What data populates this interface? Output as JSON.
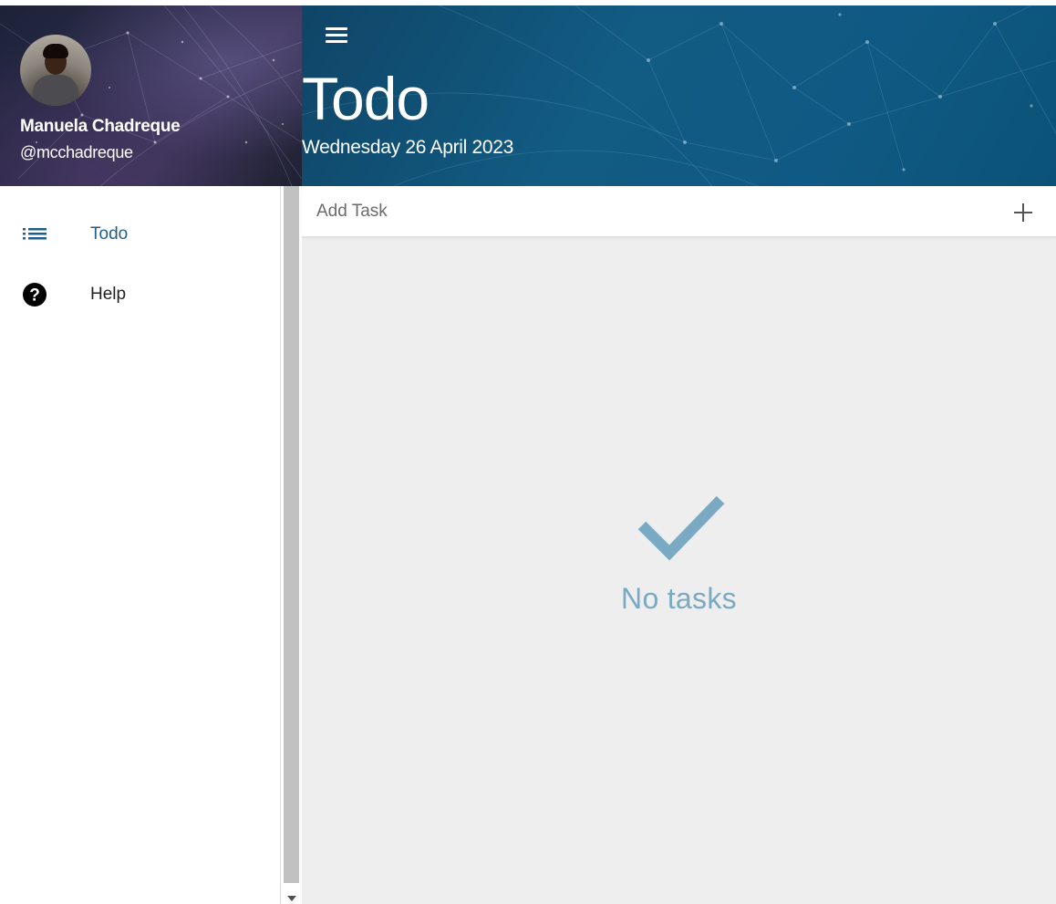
{
  "profile": {
    "name": "Manuela Chadreque",
    "handle": "@mcchadreque"
  },
  "nav": {
    "items": [
      {
        "label": "Todo",
        "icon": "list-icon",
        "active": true
      },
      {
        "label": "Help",
        "icon": "help-circle-icon",
        "active": false
      }
    ]
  },
  "header": {
    "title": "Todo",
    "date": "Wednesday 26 April 2023",
    "menu_icon": "hamburger-menu-icon"
  },
  "add_task": {
    "placeholder": "Add Task",
    "value": "",
    "button_icon": "plus-icon"
  },
  "empty_state": {
    "icon": "checkmark-icon",
    "text": "No tasks"
  },
  "colors": {
    "header_bg": "#125b82",
    "accent": "#1f5f8b",
    "empty_state": "#7aa9c3",
    "main_bg": "#eeeeee"
  }
}
